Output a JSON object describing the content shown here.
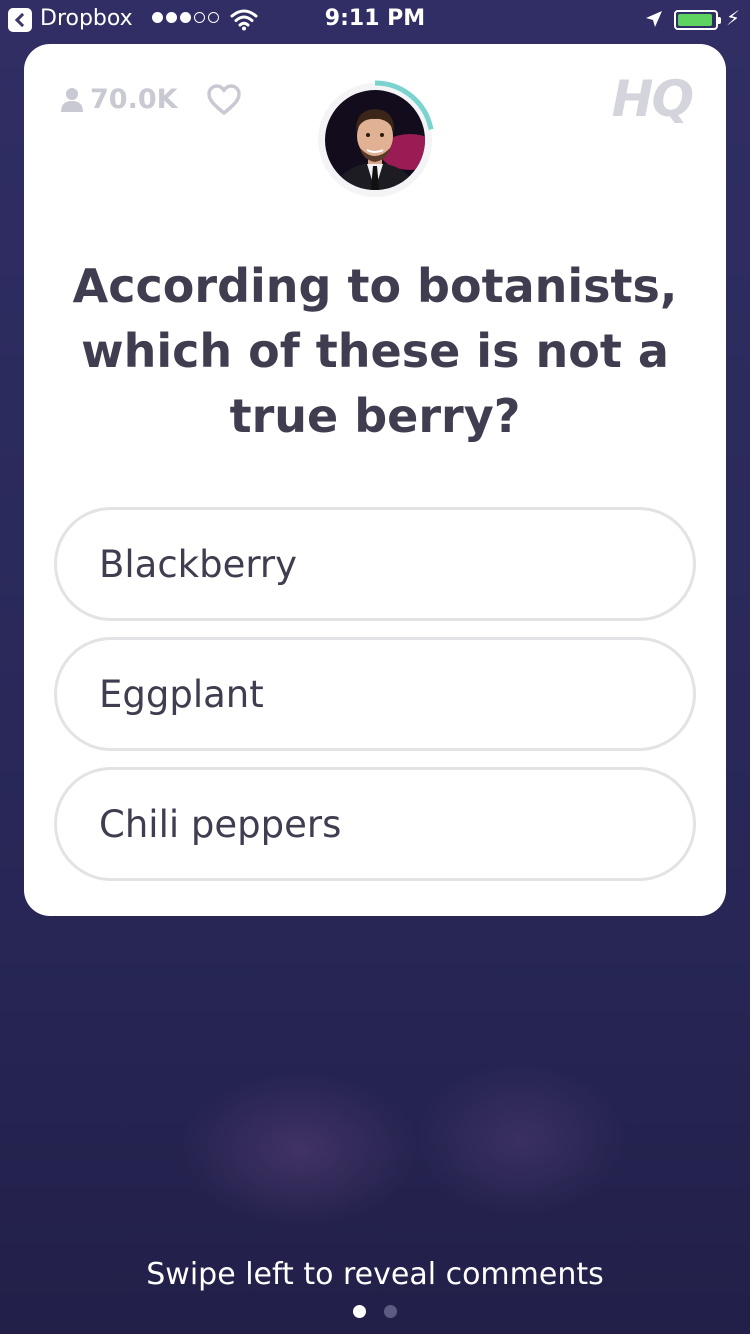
{
  "status_bar": {
    "back_app": "Dropbox",
    "time": "9:11 PM",
    "signal_bars": 3,
    "signal_max": 5,
    "battery_level": 0.95
  },
  "header": {
    "viewer_count": "70.0K",
    "logo": "HQ",
    "timer_progress": 0.22
  },
  "question": "According to botanists, which of these is not a true berry?",
  "answers": [
    "Blackberry",
    "Eggplant",
    "Chili peppers"
  ],
  "footer": {
    "hint": "Swipe left to reveal comments",
    "page_count": 2,
    "active_page": 0
  },
  "colors": {
    "background": "#2b2a5c",
    "card": "#ffffff",
    "text": "#3f3d4f",
    "muted": "#c9c9d3",
    "timer": "#7ad3cf"
  },
  "icons": [
    "back-arrow-icon",
    "wifi-icon",
    "location-arrow-icon",
    "battery-icon",
    "charging-bolt-icon",
    "person-icon",
    "heart-icon",
    "hq-logo"
  ]
}
